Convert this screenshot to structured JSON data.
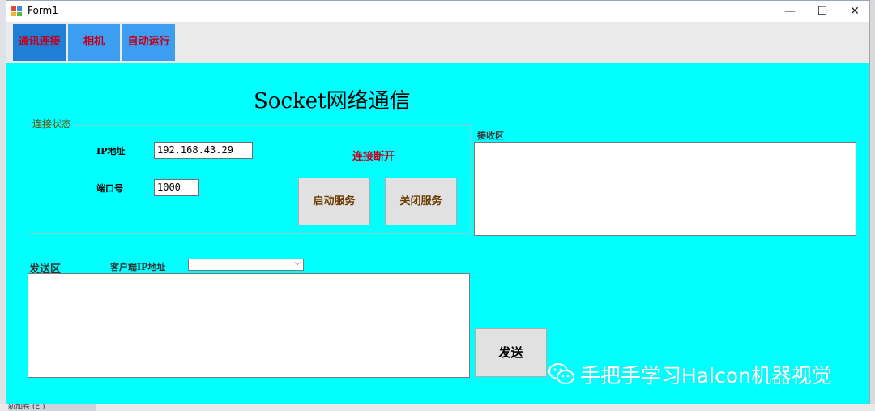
{
  "window": {
    "title": "Form1"
  },
  "desktop": {
    "bottom_text": "新加卷 (E:)"
  },
  "titlebar_controls": {
    "minimize": "—",
    "maximize": "☐",
    "close": "✕"
  },
  "toolbar": [
    {
      "label": "通讯连接",
      "active": true
    },
    {
      "label": "相机",
      "active": false
    },
    {
      "label": "自动运行",
      "active": false
    }
  ],
  "main": {
    "heading": "Socket网络通信",
    "connection": {
      "group_title": "连接状态",
      "ip_label": "IP地址",
      "ip_value": "192.168.43.29",
      "port_label": "端口号",
      "port_value": "1000",
      "status": "连接断开",
      "start_button": "启动服务",
      "stop_button": "关闭服务"
    },
    "receive": {
      "label": "接收区"
    },
    "send": {
      "label": "发送区",
      "client_ip_label": "客户端IP地址",
      "client_ip_value": "",
      "send_button": "发送"
    },
    "watermark": "手把手学习Halcon机器视觉"
  },
  "colors": {
    "content_bg": "#00ffff",
    "active_nav": "#1f7fd6",
    "nav": "#3d9df0",
    "nav_text": "#c1001f",
    "status_text": "#c1001f"
  }
}
